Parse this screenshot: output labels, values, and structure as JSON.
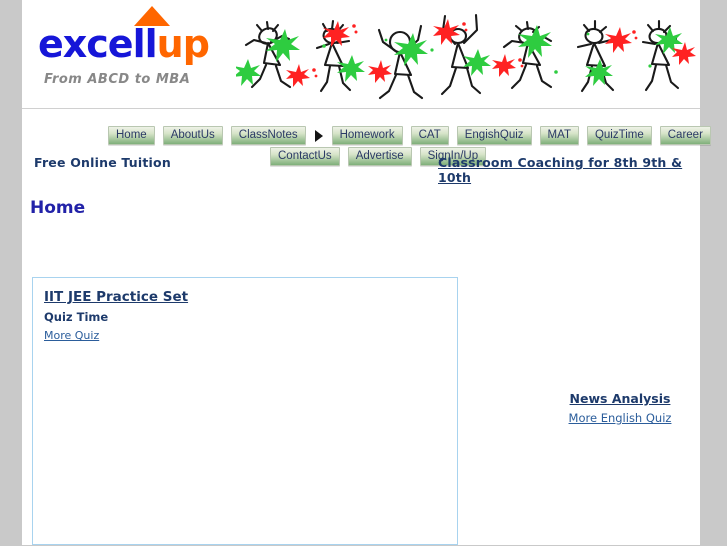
{
  "site": {
    "logo": {
      "text_part_1": "exce",
      "text_part_2": "ll",
      "text_part_3": "up",
      "full": "excellup",
      "arrow_icon": "up-arrow-icon",
      "tagline": "From  ABCD to MBA",
      "blue": "#1616d8",
      "orange": "#ff6600"
    },
    "banner": {
      "alt": "dancing-stick-figures-banner",
      "green": "#2ecc40",
      "red": "#ff2222",
      "ink": "#1a1a1a"
    }
  },
  "nav": {
    "row1": [
      {
        "label": "Home"
      },
      {
        "label": "AboutUs"
      },
      {
        "label": "ClassNotes"
      },
      {
        "label": "Homework"
      },
      {
        "label": "CAT"
      },
      {
        "label": "EngishQuiz"
      },
      {
        "label": "MAT"
      },
      {
        "label": "QuizTime"
      },
      {
        "label": "Career"
      }
    ],
    "row2": [
      {
        "label": "ContactUs"
      },
      {
        "label": "Advertise"
      },
      {
        "label": "SignIn/Up"
      }
    ],
    "separator_icon": "right-triangle-icon"
  },
  "subheader": {
    "tagline": "Free Online Tuition",
    "coaching_link": "Classroom Coaching for 8th 9th & 10th"
  },
  "page": {
    "title": "Home"
  },
  "practice_box": {
    "title": "IIT JEE Practice Set",
    "subtitle": "Quiz Time",
    "more_link": "More Quiz",
    "border_color": "#a8d3ef"
  },
  "news_block": {
    "title": "News Analysis",
    "more_link": "More English Quiz"
  },
  "colors": {
    "page_background": "#c9c9c9",
    "content_background": "#ffffff",
    "navy_text": "#1d3a6b",
    "link_blue": "#2b5d9b",
    "title_blue": "#2222a8",
    "nav_button_green": "#7fb07a"
  }
}
